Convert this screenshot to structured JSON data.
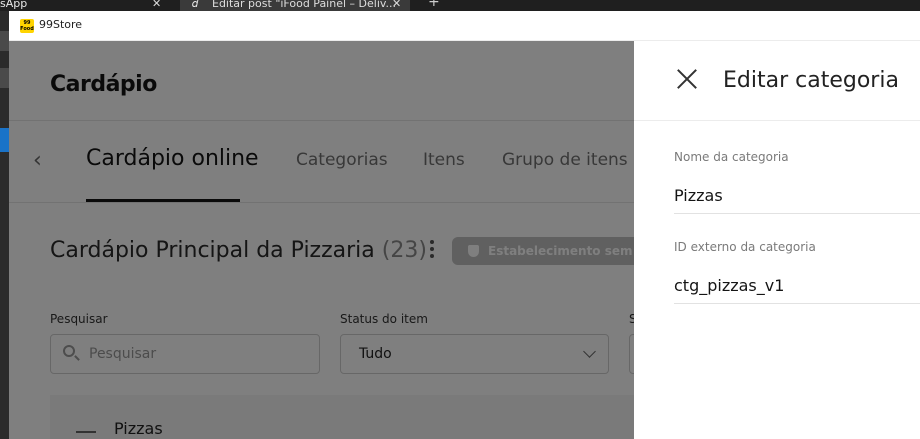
{
  "browser": {
    "tabs": [
      {
        "label": "sApp"
      },
      {
        "label": "Editar post \"iFood Painel – Deliv..."
      }
    ],
    "new_tab": "+"
  },
  "app": {
    "title": "99Store",
    "icon_text": "99 Food"
  },
  "page": {
    "title": "Cardápio",
    "tabs": [
      {
        "label": "Cardápio online",
        "active": true
      },
      {
        "label": "Categorias"
      },
      {
        "label": "Itens"
      },
      {
        "label": "Grupo de itens a"
      }
    ],
    "menu": {
      "name": "Cardápio Principal da Pizzaria",
      "count": "(23)"
    },
    "status_badge": "Estabelecimento sem a",
    "filters": {
      "search_label": "Pesquisar",
      "search_placeholder": "Pesquisar",
      "status_label": "Status do item",
      "status_value": "Tudo",
      "third_label": "S"
    },
    "category_row": {
      "name": "Pizzas"
    }
  },
  "drawer": {
    "title": "Editar categoria",
    "fields": [
      {
        "label": "Nome da categoria",
        "value": "Pizzas"
      },
      {
        "label": "ID externo da categoria",
        "value": "ctg_pizzas_v1"
      }
    ]
  },
  "colors": {
    "accent_yellow": "#ffd400",
    "text_dark": "#151515",
    "overlay": "rgba(0,0,0,0.5)"
  }
}
